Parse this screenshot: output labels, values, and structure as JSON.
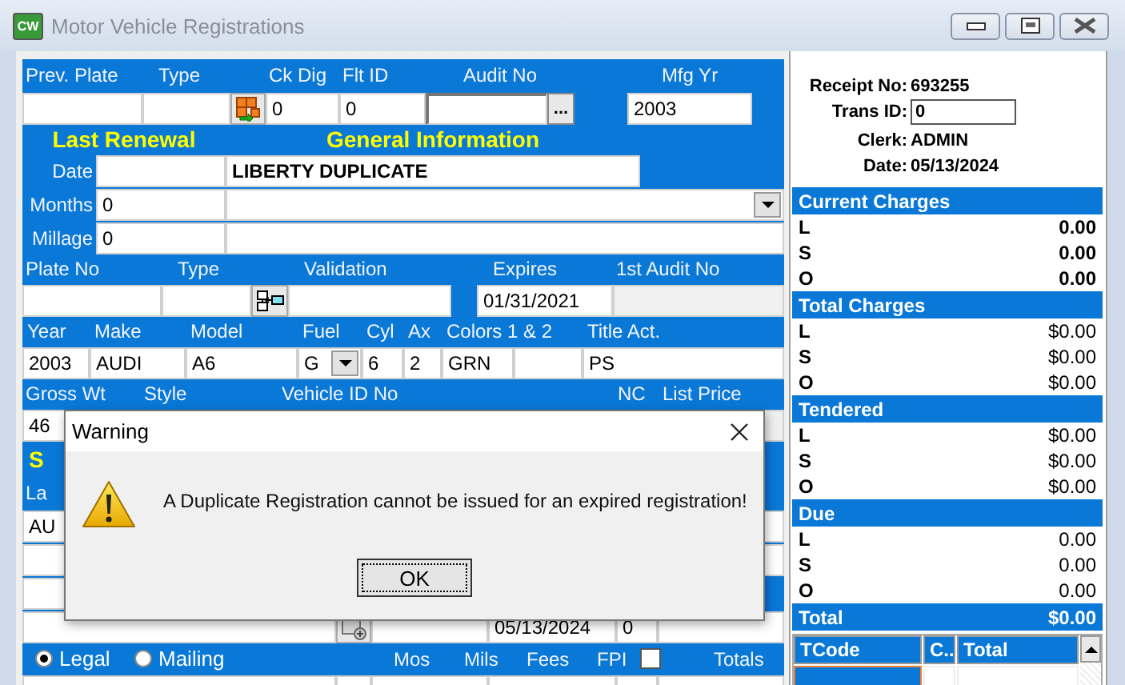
{
  "window": {
    "title": "Motor Vehicle Registrations",
    "app_badge": "CW"
  },
  "plate_history": {
    "prev_plate_label": "Prev. Plate",
    "type_label": "Type",
    "ck_dig_label": "Ck Dig",
    "ck_dig": "0",
    "flt_id_label": "Flt ID",
    "flt_id": "0",
    "audit_no_label": "Audit No",
    "browse_button": "...",
    "mfg_yr_label": "Mfg Yr",
    "mfg_yr": "2003"
  },
  "last_renewal": {
    "title": "Last Renewal",
    "date_label": "Date",
    "months_label": "Months",
    "months": "0",
    "millage_label": "Millage",
    "millage": "0"
  },
  "general_information": {
    "title": "General Information",
    "name": "LIBERTY DUPLICATE"
  },
  "plate": {
    "plate_no_label": "Plate No",
    "type_label": "Type",
    "validation_label": "Validation",
    "expires_label": "Expires",
    "expires": "01/31/2021",
    "first_audit_no_label": "1st Audit No"
  },
  "vehicle": {
    "year_label": "Year",
    "make_label": "Make",
    "model_label": "Model",
    "fuel_label": "Fuel",
    "cyl_label": "Cyl",
    "ax_label": "Ax",
    "colors_label": "Colors 1 & 2",
    "title_act_label": "Title Act.",
    "year": "2003",
    "make": "AUDI",
    "model": "A6",
    "fuel": "G",
    "cyl": "6",
    "ax": "2",
    "color_1": "GRN",
    "title_act": "PS"
  },
  "weight": {
    "gross_wt_label": "Gross Wt",
    "style_label": "Style",
    "vin_label": "Vehicle ID No",
    "nc_label": "NC",
    "list_price_label": "List Price",
    "gross_wt": "46"
  },
  "partly_covered": {
    "title": "S",
    "label": "La",
    "value": "AU"
  },
  "issue_row": {
    "date": "05/13/2024",
    "count": "0"
  },
  "totals_bar": {
    "address_options": [
      {
        "label": "Legal",
        "selected": true
      },
      {
        "label": "Mailing",
        "selected": false
      }
    ],
    "mos_label": "Mos",
    "mils_label": "Mils",
    "fees_label": "Fees",
    "fpi_label": "FPI",
    "fpi_checked": false,
    "totals_label": "Totals"
  },
  "receipt": {
    "receipt_no_label": "Receipt No:",
    "receipt_no": "693255",
    "trans_id_label": "Trans ID:",
    "trans_id": "0",
    "clerk_label": "Clerk:",
    "clerk": "ADMIN",
    "date_label": "Date:",
    "date": "05/13/2024"
  },
  "charges": [
    {
      "title": "Current Charges",
      "emphasized": true,
      "lines": [
        {
          "code": "L",
          "amount": "0.00"
        },
        {
          "code": "S",
          "amount": "0.00"
        },
        {
          "code": "O",
          "amount": "0.00"
        }
      ]
    },
    {
      "title": "Total Charges",
      "emphasized": false,
      "lines": [
        {
          "code": "L",
          "amount": "$0.00"
        },
        {
          "code": "S",
          "amount": "$0.00"
        },
        {
          "code": "O",
          "amount": "$0.00"
        }
      ]
    },
    {
      "title": "Tendered",
      "emphasized": false,
      "lines": [
        {
          "code": "L",
          "amount": "$0.00"
        },
        {
          "code": "S",
          "amount": "$0.00"
        },
        {
          "code": "O",
          "amount": "$0.00"
        }
      ]
    },
    {
      "title": "Due",
      "emphasized": false,
      "lines": [
        {
          "code": "L",
          "amount": "0.00"
        },
        {
          "code": "S",
          "amount": "0.00"
        },
        {
          "code": "O",
          "amount": "0.00"
        }
      ]
    }
  ],
  "total": {
    "label": "Total",
    "amount": "$0.00"
  },
  "transactions": {
    "columns": [
      "TCode",
      "C..",
      "Total"
    ],
    "rows": [
      {
        "selected": true
      }
    ]
  },
  "dialog": {
    "title": "Warning",
    "message": "A Duplicate Registration cannot be issued for an expired registration!",
    "button": "OK"
  }
}
